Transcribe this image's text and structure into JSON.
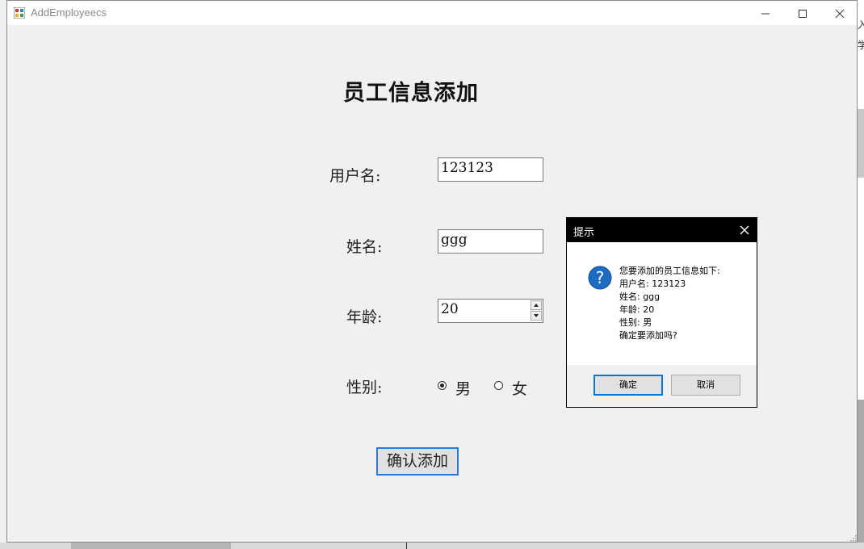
{
  "window": {
    "title": "AddEmployeecs"
  },
  "form": {
    "title": "员工信息添加",
    "username_label": "用户名:",
    "username_value": "123123",
    "name_label": "姓名:",
    "name_value": "ggg",
    "age_label": "年龄:",
    "age_value": "20",
    "gender_label": "性别:",
    "gender_options": [
      "男",
      "女"
    ],
    "gender_selected": "男",
    "confirm_label": "确认添加"
  },
  "dialog": {
    "title": "提示",
    "icon": "question-icon",
    "lines": [
      "您要添加的员工信息如下:",
      "用户名: 123123",
      "姓名: ggg",
      "年龄: 20",
      "性别: 男",
      "确定要添加吗?"
    ],
    "ok_label": "确定",
    "cancel_label": "取消"
  },
  "background": {
    "fragments": [
      "入",
      "学"
    ]
  },
  "colors": {
    "accent": "#0078d7",
    "confirm_border": "#2b79d0",
    "dialog_titlebar": "#000000",
    "question_icon": "#1e6bc2"
  }
}
